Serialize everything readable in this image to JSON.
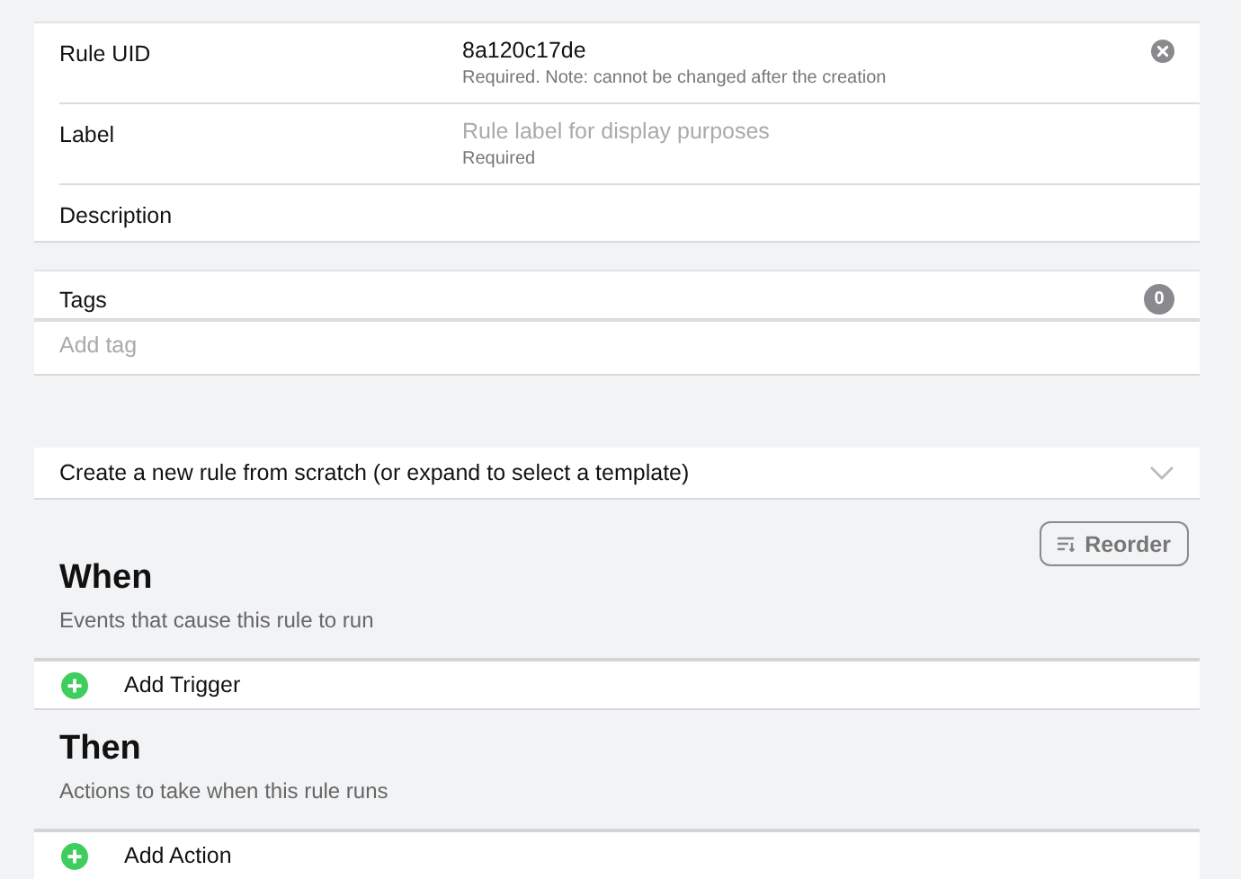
{
  "fields": [
    {
      "label": "Rule UID",
      "value": "8a120c17de",
      "hint": "Required. Note: cannot be changed after the creation",
      "clear_button": true
    },
    {
      "label": "Label",
      "placeholder": "Rule label for display purposes",
      "hint": "Required"
    },
    {
      "label": "Description"
    }
  ],
  "tags": {
    "label": "Tags",
    "count": "0",
    "placeholder": "Add tag"
  },
  "template": {
    "label": "Create a new rule from scratch (or expand to select a template)",
    "expanded": false
  },
  "sections": [
    {
      "title": "When",
      "description": "Events that cause this rule to run",
      "reorder_button": "Reorder",
      "add_label": "Add Trigger"
    },
    {
      "title": "Then",
      "description": "Actions to take when this rule runs",
      "add_label": "Add Action"
    }
  ]
}
